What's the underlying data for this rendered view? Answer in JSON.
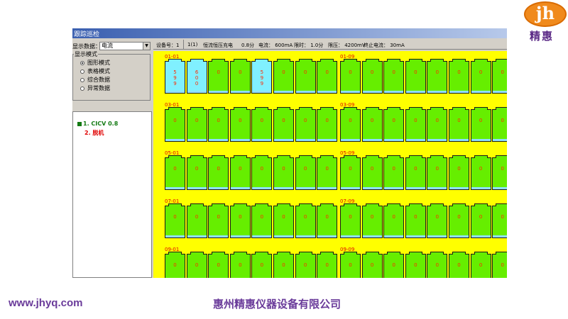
{
  "logo": {
    "mark": "jh",
    "name": "精惠"
  },
  "window": {
    "title": "跟踪巡检"
  },
  "left_panel": {
    "display_data_label": "显示数据：",
    "display_data_value": "电流",
    "mode_group_title": "显示模式",
    "modes": [
      {
        "label": "图形模式",
        "selected": true
      },
      {
        "label": "表格模式",
        "selected": false
      },
      {
        "label": "综合数据",
        "selected": false
      },
      {
        "label": "异常数据",
        "selected": false
      }
    ],
    "tree": [
      {
        "label": "1. CICV  0.8",
        "color": "#137a13"
      },
      {
        "label": "2. 脱机",
        "color": "#e00000"
      }
    ]
  },
  "infobar": {
    "device": "设备号：1",
    "step": "1(1)",
    "mode": "恒流恒压充电",
    "time": "0.8分",
    "current": "电流： 600mA",
    "time_limit": "限时： 1.0分",
    "voltage_limit": "限压： 4200mV",
    "end_current": "终止电流： 30mA"
  },
  "grid": {
    "groups": [
      {
        "label": "01-01",
        "values": [
          "5\n9\n9",
          "6\n0\n0",
          "0",
          "0",
          "5\n9\n9",
          "0",
          "0",
          "0"
        ],
        "highlight": [
          0,
          1,
          4
        ]
      },
      {
        "label": "01-09",
        "values": [
          "0",
          "0",
          "0",
          "0",
          "0",
          "0",
          "0",
          "0"
        ]
      },
      {
        "label": "03-01",
        "values": [
          "0",
          "0",
          "0",
          "0",
          "0",
          "0",
          "0",
          "0"
        ]
      },
      {
        "label": "03-09",
        "values": [
          "0",
          "0",
          "0",
          "0",
          "0",
          "0",
          "0",
          "0"
        ]
      },
      {
        "label": "05-01",
        "values": [
          "0",
          "0",
          "0",
          "0",
          "0",
          "0",
          "0",
          "0"
        ]
      },
      {
        "label": "05-09",
        "values": [
          "0",
          "0",
          "0",
          "0",
          "0",
          "0",
          "0",
          "0"
        ]
      },
      {
        "label": "07-01",
        "values": [
          "0",
          "0",
          "0",
          "0",
          "0",
          "0",
          "0",
          "0"
        ]
      },
      {
        "label": "07-09",
        "values": [
          "0",
          "0",
          "0",
          "0",
          "0",
          "0",
          "0",
          "0"
        ]
      },
      {
        "label": "09-01",
        "values": [
          "0",
          "0",
          "0",
          "0",
          "0",
          "0",
          "0",
          "0"
        ]
      },
      {
        "label": "09-09",
        "values": [
          "0",
          "0",
          "0",
          "0",
          "0",
          "0",
          "0",
          "0"
        ]
      }
    ]
  },
  "footer": {
    "url": "www.jhyq.com",
    "company": "惠州精惠仪器设备有限公司"
  },
  "colors": {
    "accent_purple": "#6a3b9a",
    "logo_orange": "#f08a1c",
    "grid_background": "#ffff00",
    "cell_green": "#66ee00",
    "cell_cyan": "#80f0ff",
    "value_red": "#ff2a00"
  }
}
